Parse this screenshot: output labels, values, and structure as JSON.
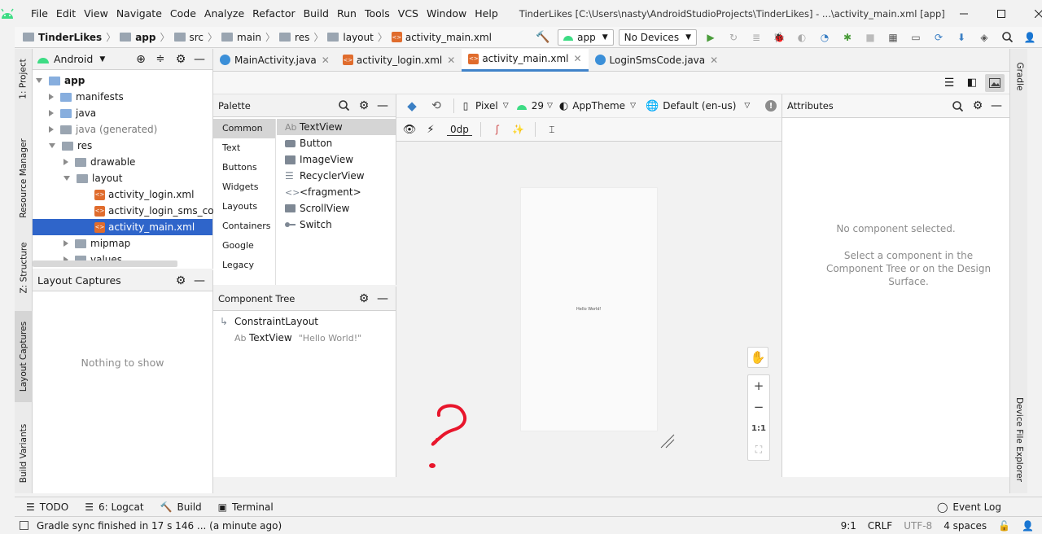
{
  "window": {
    "title": "TinderLikes [C:\\Users\\nasty\\AndroidStudioProjects\\TinderLikes] - ...\\activity_main.xml [app]"
  },
  "menu": [
    "File",
    "Edit",
    "View",
    "Navigate",
    "Code",
    "Analyze",
    "Refactor",
    "Build",
    "Run",
    "Tools",
    "VCS",
    "Window",
    "Help"
  ],
  "breadcrumb": [
    "TinderLikes",
    "app",
    "src",
    "main",
    "res",
    "layout",
    "activity_main.xml"
  ],
  "toolbar": {
    "run_config": "app",
    "device": "No Devices"
  },
  "side_tabs_left": {
    "project": "1: Project",
    "resource_manager": "Resource Manager",
    "structure": "Z: Structure",
    "layout_captures": "Layout Captures",
    "build_variants": "Build Variants"
  },
  "side_tabs_right": {
    "gradle": "Gradle",
    "device_file_explorer": "Device File Explorer"
  },
  "project": {
    "view_mode": "Android",
    "tree": [
      {
        "label": "app",
        "level": 0,
        "expanded": true,
        "bold": true
      },
      {
        "label": "manifests",
        "level": 1
      },
      {
        "label": "java",
        "level": 1
      },
      {
        "label": "java (generated)",
        "level": 1,
        "muted": true
      },
      {
        "label": "res",
        "level": 1,
        "expanded": true
      },
      {
        "label": "drawable",
        "level": 2
      },
      {
        "label": "layout",
        "level": 2,
        "expanded": true
      },
      {
        "label": "activity_login.xml",
        "level": 3,
        "file": true
      },
      {
        "label": "activity_login_sms_code.",
        "level": 3,
        "file": true
      },
      {
        "label": "activity_main.xml",
        "level": 3,
        "file": true,
        "selected": true
      },
      {
        "label": "mipmap",
        "level": 2
      },
      {
        "label": "values",
        "level": 2
      }
    ]
  },
  "captures": {
    "title": "Layout Captures",
    "empty": "Nothing to show"
  },
  "editor_tabs": [
    {
      "label": "MainActivity.java",
      "type": "java"
    },
    {
      "label": "activity_login.xml",
      "type": "xml"
    },
    {
      "label": "activity_main.xml",
      "type": "xml",
      "active": true
    },
    {
      "label": "LoginSmsCode.java",
      "type": "java"
    }
  ],
  "palette": {
    "title": "Palette",
    "categories": [
      "Common",
      "Text",
      "Buttons",
      "Widgets",
      "Layouts",
      "Containers",
      "Google",
      "Legacy"
    ],
    "items": [
      {
        "label": "TextView",
        "icon": "Ab"
      },
      {
        "label": "Button",
        "icon": "btn"
      },
      {
        "label": "ImageView",
        "icon": "img"
      },
      {
        "label": "RecyclerView",
        "icon": "list"
      },
      {
        "label": "<fragment>",
        "icon": "code"
      },
      {
        "label": "ScrollView",
        "icon": "scroll"
      },
      {
        "label": "Switch",
        "icon": "switch"
      }
    ]
  },
  "design_toolbar": {
    "device": "Pixel",
    "api": "29",
    "theme": "AppTheme",
    "locale": "Default (en-us)",
    "margin": "0dp"
  },
  "component_tree": {
    "title": "Component Tree",
    "root": "ConstraintLayout",
    "child": "TextView",
    "child_value": "\"Hello World!\""
  },
  "canvas": {
    "preview_text": "Hello World!"
  },
  "zoom": {
    "ratio": "1:1"
  },
  "attributes": {
    "title": "Attributes",
    "empty_title": "No component selected.",
    "empty_hint": "Select a component in the Component Tree or on the Design Surface."
  },
  "bottom_tools": {
    "todo": "TODO",
    "logcat": "6: Logcat",
    "build": "Build",
    "terminal": "Terminal",
    "event_log": "Event Log"
  },
  "status": {
    "message": "Gradle sync finished in 17 s 146 ... (a minute ago)",
    "position": "9:1",
    "line_sep": "CRLF",
    "encoding": "UTF-8",
    "indent": "4 spaces"
  },
  "colors": {
    "accent": "#4083c9",
    "selection": "#2f65ca",
    "annotation": "#e8162c",
    "android_green": "#3ddc84"
  }
}
